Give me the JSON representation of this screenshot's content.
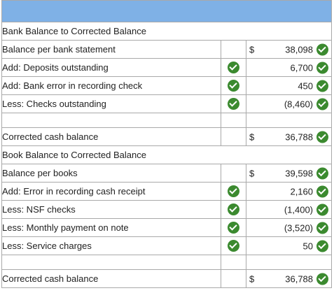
{
  "bank_section": {
    "heading": "Bank Balance to Corrected Balance",
    "rows": [
      {
        "label": "Balance per bank statement",
        "currency": "$",
        "value": "38,098",
        "left_check": false
      },
      {
        "label": "Add: Deposits outstanding",
        "currency": "",
        "value": "6,700",
        "left_check": true
      },
      {
        "label": "Add: Bank error in recording check",
        "currency": "",
        "value": "450",
        "left_check": true
      },
      {
        "label": "Less: Checks outstanding",
        "currency": "",
        "value": "(8,460)",
        "left_check": true
      }
    ],
    "total": {
      "label": "Corrected cash balance",
      "currency": "$",
      "value": "36,788"
    }
  },
  "book_section": {
    "heading": "Book Balance to Corrected Balance",
    "rows": [
      {
        "label": "Balance per books",
        "currency": "$",
        "value": "39,598",
        "left_check": false
      },
      {
        "label": "Add: Error in recording cash receipt",
        "currency": "",
        "value": "2,160",
        "left_check": true
      },
      {
        "label": "Less: NSF checks",
        "currency": "",
        "value": "(1,400)",
        "left_check": true
      },
      {
        "label": "Less: Monthly payment on note",
        "currency": "",
        "value": "(3,520)",
        "left_check": true
      },
      {
        "label": "Less: Service charges",
        "currency": "",
        "value": "50",
        "left_check": true
      }
    ],
    "total": {
      "label": "Corrected cash balance",
      "currency": "$",
      "value": "36,788"
    }
  },
  "colors": {
    "header": "#7fb1e6",
    "check": "#3b8a2f"
  },
  "icons": {
    "check": "check-circle-icon"
  }
}
